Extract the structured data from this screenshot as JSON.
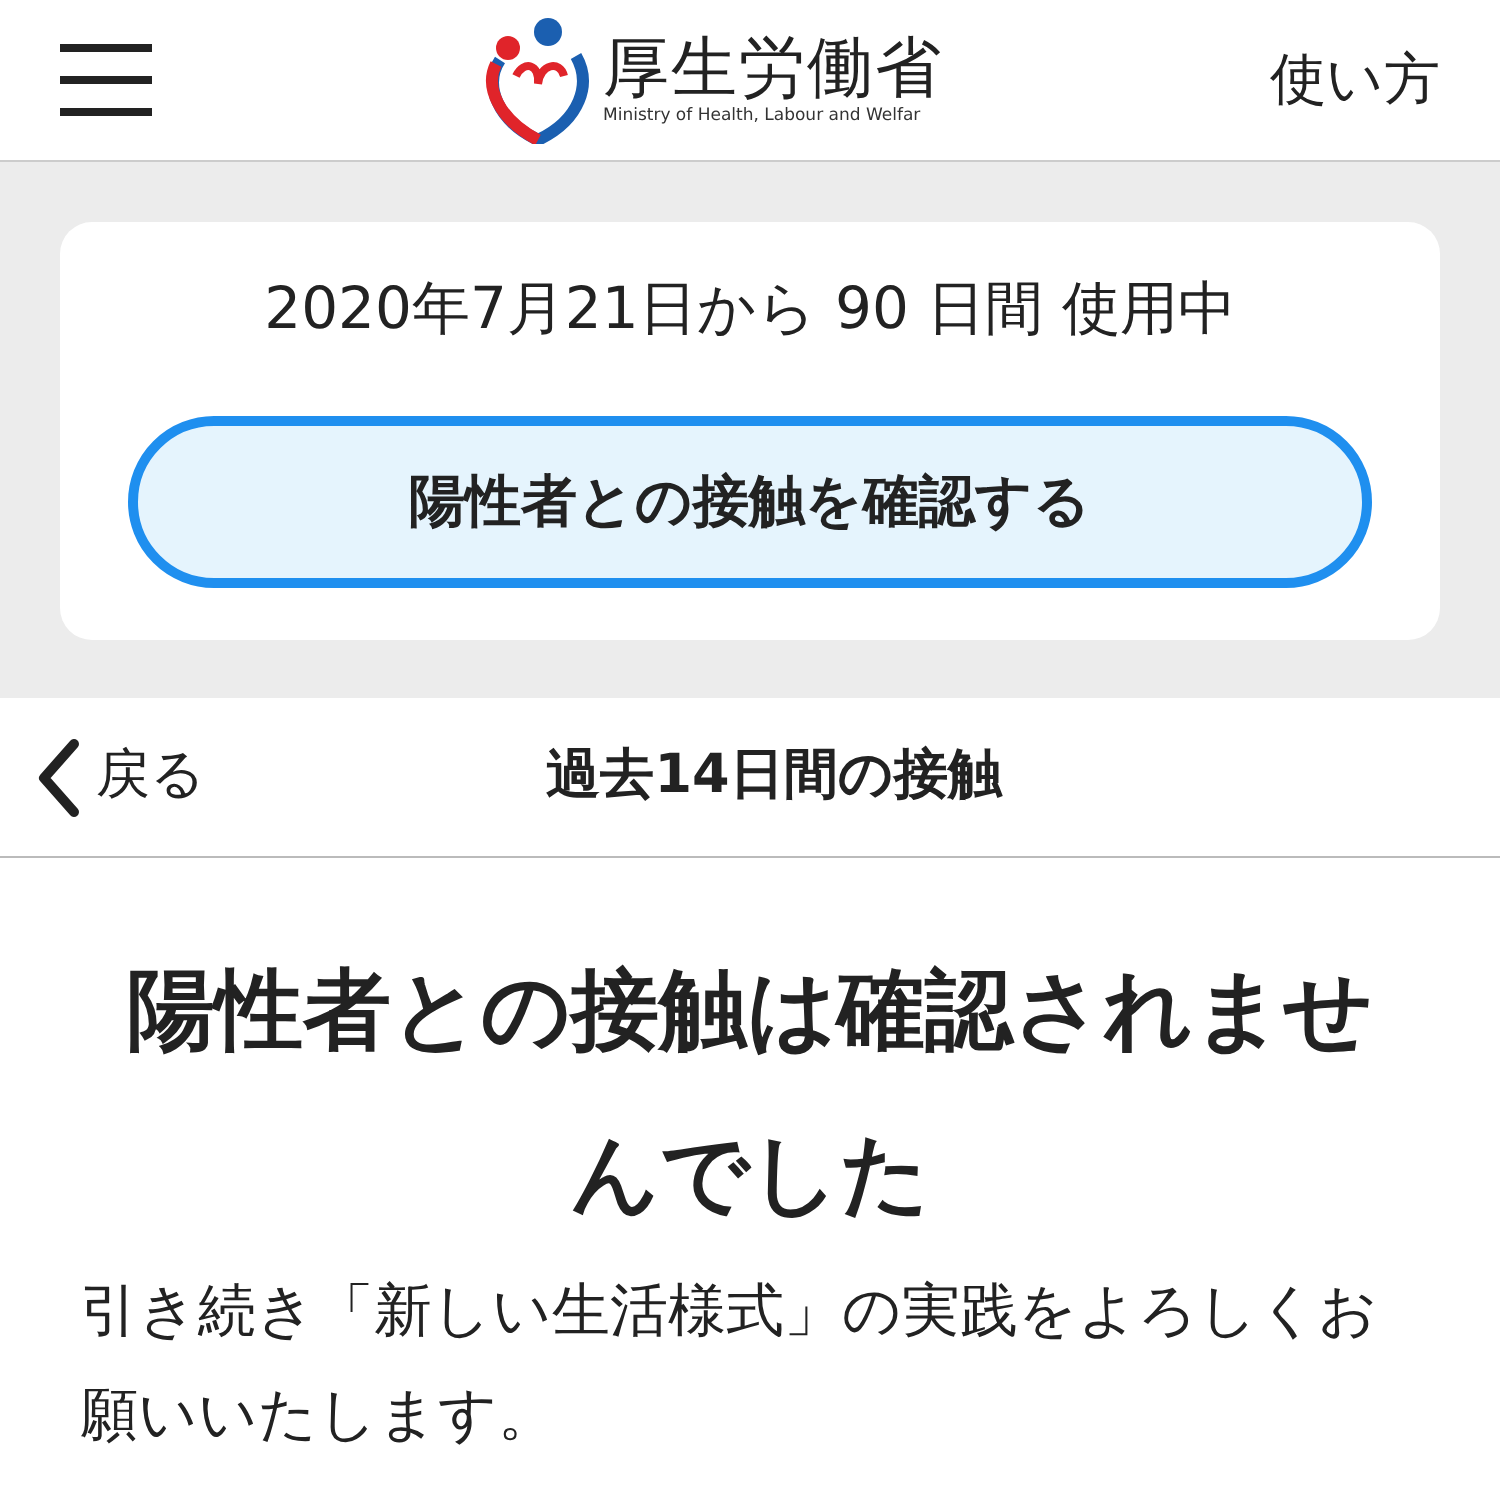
{
  "header": {
    "logo_title": "厚生労働省",
    "logo_subtitle": "Ministry of Health, Labour and Welfar",
    "help_link": "使い方"
  },
  "usage_card": {
    "usage_text": "2020年7月21日から 90 日間 使用中",
    "check_button": "陽性者との接触を確認する"
  },
  "nav": {
    "back": "戻る",
    "title": "過去14日間の接触"
  },
  "result": {
    "heading": "陽性者との接触は確認されませんでした",
    "message": "引き続き「新しい生活様式」の実践をよろしくお願いいたします。"
  }
}
